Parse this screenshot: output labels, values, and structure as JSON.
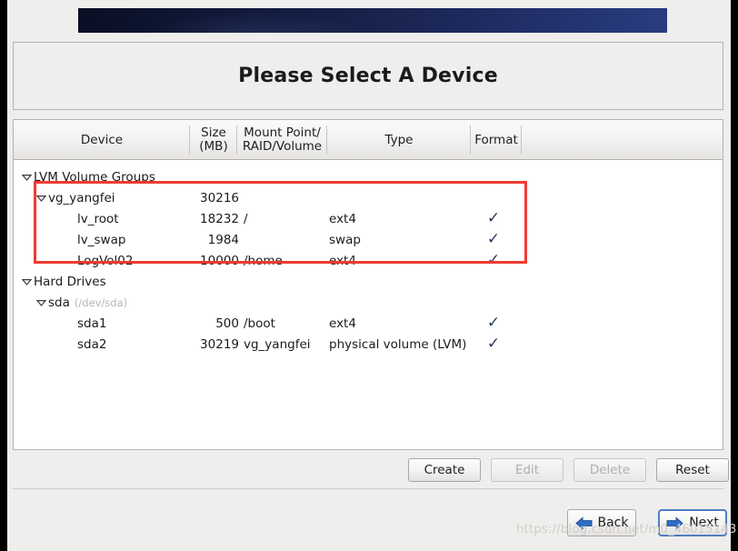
{
  "window": {
    "title": "Please Select A Device"
  },
  "table": {
    "columns": [
      {
        "id": "device",
        "label": "Device"
      },
      {
        "id": "size",
        "label": "Size\n(MB)",
        "line1": "Size",
        "line2": "(MB)"
      },
      {
        "id": "mount",
        "label": "Mount Point/\nRAID/Volume",
        "line1": "Mount Point/",
        "line2": "RAID/Volume"
      },
      {
        "id": "type",
        "label": "Type"
      },
      {
        "id": "format",
        "label": "Format"
      }
    ],
    "rows": [
      {
        "indent": 0,
        "expander": "expanded",
        "device": "LVM Volume Groups",
        "size": "",
        "mount": "",
        "type": "",
        "format": false
      },
      {
        "indent": 1,
        "expander": "expanded",
        "device": "vg_yangfei",
        "size": "30216",
        "mount": "",
        "type": "",
        "format": false
      },
      {
        "indent": 2,
        "expander": "none",
        "device": "lv_root",
        "size": "18232",
        "mount": "/",
        "type": "ext4",
        "format": true
      },
      {
        "indent": 2,
        "expander": "none",
        "device": "lv_swap",
        "size": "1984",
        "mount": "",
        "type": "swap",
        "format": true
      },
      {
        "indent": 2,
        "expander": "none",
        "device": "LogVol02",
        "size": "10000",
        "mount": "/home",
        "type": "ext4",
        "format": true
      },
      {
        "indent": 0,
        "expander": "expanded",
        "device": "Hard Drives",
        "size": "",
        "mount": "",
        "type": "",
        "format": false
      },
      {
        "indent": 1,
        "expander": "expanded",
        "device": "sda",
        "devicepath": "(/dev/sda)",
        "size": "",
        "mount": "",
        "type": "",
        "format": false
      },
      {
        "indent": 2,
        "expander": "none",
        "device": "sda1",
        "size": "500",
        "mount": "/boot",
        "type": "ext4",
        "format": true
      },
      {
        "indent": 2,
        "expander": "none",
        "device": "sda2",
        "size": "30219",
        "mount": "vg_yangfei",
        "type": "physical volume (LVM)",
        "format": true
      }
    ],
    "format_check_glyph": "✓"
  },
  "toolbar": {
    "create_label": "Create",
    "edit_label": "Edit",
    "delete_label": "Delete",
    "reset_label": "Reset"
  },
  "navigation": {
    "back_label": "Back",
    "next_label": "Next"
  },
  "watermark": {
    "text": "https://blog.csdn.net/m0_46015143"
  },
  "colors": {
    "annotation_red": "#ef3b33",
    "banner_dark": "#0a0f24",
    "banner_light": "#283d80",
    "check_navy": "#2b3a5c",
    "focus_blue": "#4d7fc4"
  }
}
